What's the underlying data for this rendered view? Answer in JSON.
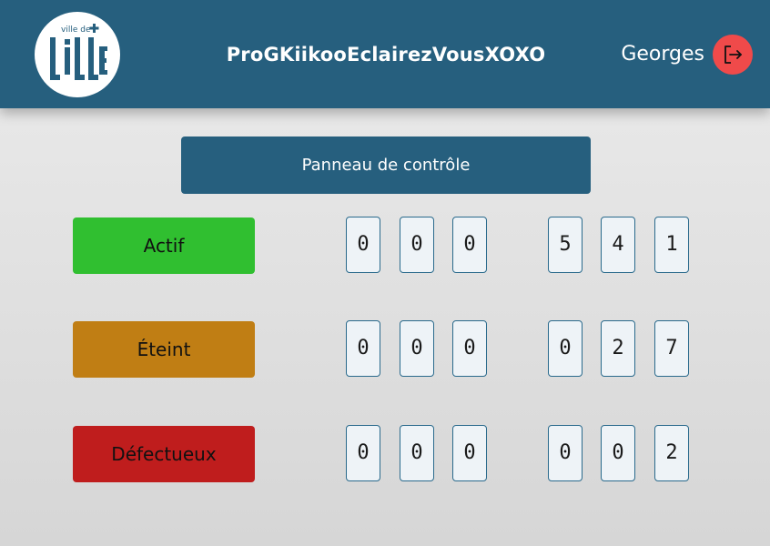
{
  "header": {
    "logo_text_small": "ville de",
    "logo_text_big": "lille",
    "app_title": "ProGKiikooEclairezVousXOXO",
    "user_name": "Georges",
    "logout_icon": "logout-icon"
  },
  "panel": {
    "title": "Panneau de contrôle"
  },
  "colors": {
    "header_bg": "#265f7e",
    "active": "#30bf30",
    "off": "#c07e14",
    "faulty": "#bf1d1d",
    "logout": "#f04a4a"
  },
  "statuses": [
    {
      "label": "Actif",
      "digits": [
        "0",
        "0",
        "0",
        "5",
        "4",
        "1"
      ]
    },
    {
      "label": "Éteint",
      "digits": [
        "0",
        "0",
        "0",
        "0",
        "2",
        "7"
      ]
    },
    {
      "label": "Défectueux",
      "digits": [
        "0",
        "0",
        "0",
        "0",
        "0",
        "2"
      ]
    }
  ]
}
